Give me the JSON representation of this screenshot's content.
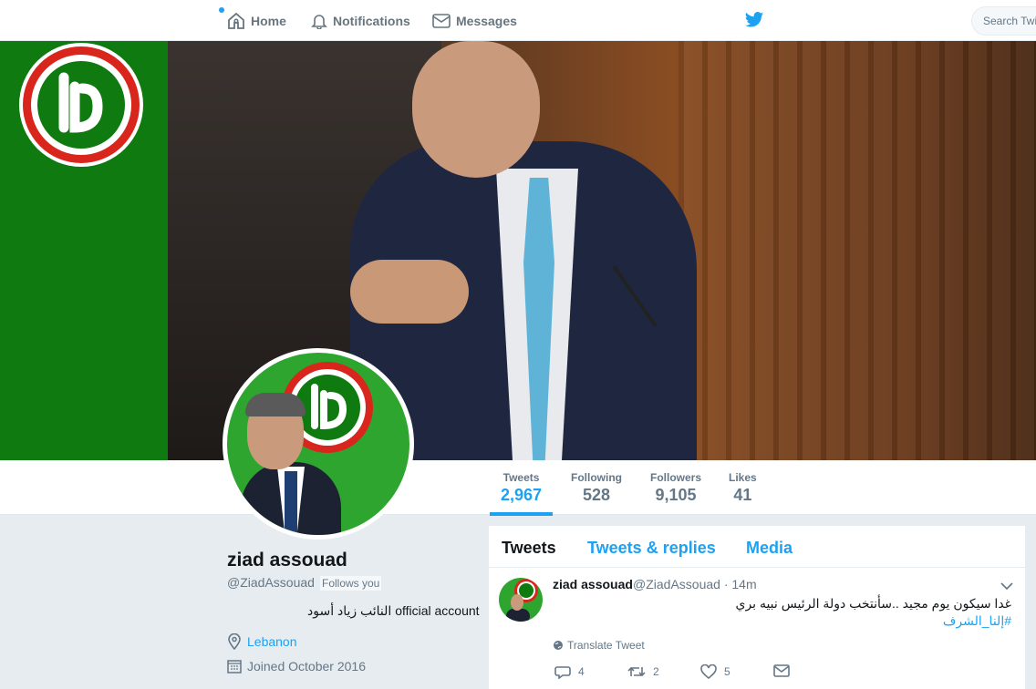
{
  "nav": {
    "home": "Home",
    "notifications": "Notifications",
    "messages": "Messages",
    "search_placeholder": "Search Twitter"
  },
  "profile": {
    "name": "ziad assouad",
    "handle": "@ZiadAssouad",
    "follows_you": "Follows you",
    "bio": "النائب زياد أسود official account",
    "location": "Lebanon",
    "joined": "Joined October 2016"
  },
  "stats": [
    {
      "label": "Tweets",
      "value": "2,967"
    },
    {
      "label": "Following",
      "value": "528"
    },
    {
      "label": "Followers",
      "value": "9,105"
    },
    {
      "label": "Likes",
      "value": "41"
    }
  ],
  "tabs": [
    "Tweets",
    "Tweets & replies",
    "Media"
  ],
  "tweet": {
    "name": "ziad assouad",
    "meta": "@ZiadAssouad · 14m",
    "text": "غدا سيكون يوم مجيد ..سأنتخب دولة الرئيس نبيه بري",
    "hashtag": "#إلنا_الشرف",
    "translate": "Translate Tweet",
    "replies": "4",
    "retweets": "2",
    "likes": "5"
  },
  "colors": {
    "accent": "#1da1f2",
    "banner_green": "#0f7a0f",
    "logo_red": "#d9261c"
  }
}
